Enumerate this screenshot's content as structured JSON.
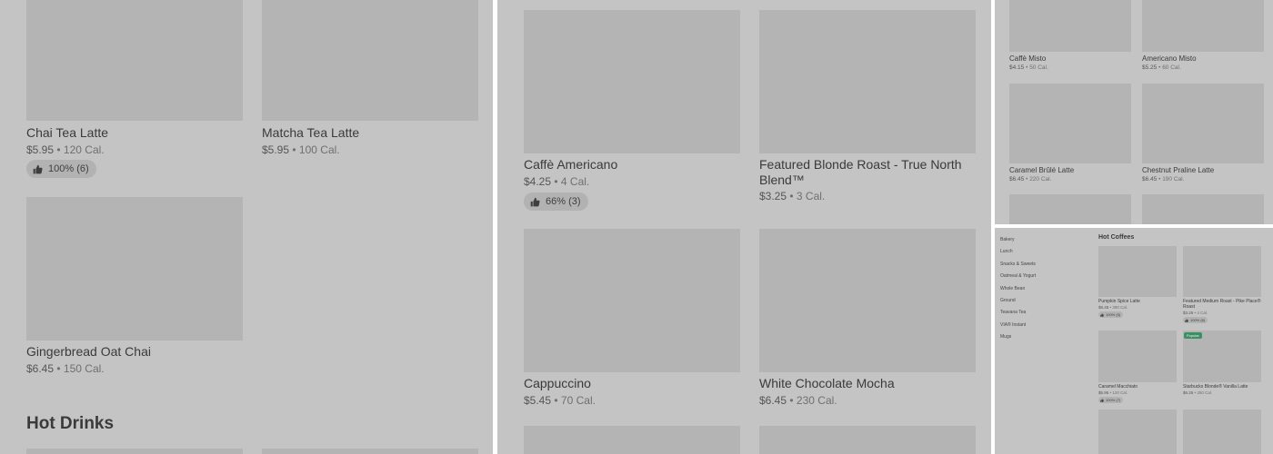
{
  "rating_glyph": "thumbs-up-icon",
  "separator": "•",
  "panel1": {
    "items": [
      {
        "name": "Chai Tea Latte",
        "price": "$5.95",
        "calories": "120 Cal.",
        "rating": "100% (6)"
      },
      {
        "name": "Matcha Tea Latte",
        "price": "$5.95",
        "calories": "100 Cal."
      },
      {
        "name": "Gingerbread Oat Chai",
        "price": "$6.45",
        "calories": "150 Cal."
      }
    ],
    "section_heading": "Hot Drinks"
  },
  "panel2": {
    "items": [
      {
        "name": "Caffè Americano",
        "price": "$4.25",
        "calories": "4 Cal.",
        "rating": "66% (3)"
      },
      {
        "name": "Featured Blonde Roast - True North Blend™",
        "price": "$3.25",
        "calories": "3 Cal."
      },
      {
        "name": "Cappuccino",
        "price": "$5.45",
        "calories": "70 Cal."
      },
      {
        "name": "White Chocolate Mocha",
        "price": "$6.45",
        "calories": "230 Cal."
      }
    ]
  },
  "panel3": {
    "items": [
      {
        "name": "Caffè Misto",
        "price": "$4.15",
        "calories": "50 Cal."
      },
      {
        "name": "Americano Misto",
        "price": "$5.25",
        "calories": "60 Cal."
      },
      {
        "name": "Caramel Brûlé Latte",
        "price": "$6.45",
        "calories": "220 Cal."
      },
      {
        "name": "Chestnut Praline Latte",
        "price": "$6.45",
        "calories": "190 Cal."
      }
    ]
  },
  "panel4": {
    "sidebar": [
      "Bakery",
      "Lunch",
      "Snacks & Sweets",
      "Oatmeal & Yogurt",
      "Whole Bean",
      "Ground",
      "Teavana Tea",
      "VIA® Instant",
      "Mugs"
    ],
    "section_title": "Hot Coffees",
    "items": [
      {
        "name": "Pumpkin Spice Latte",
        "price": "$6.45",
        "calories": "390 Cal.",
        "rating": "100% (5)"
      },
      {
        "name": "Featured Medium Roast - Pike Place® Roast",
        "price": "$3.25",
        "calories": "4 Cal.",
        "rating": "100% (6)"
      },
      {
        "name": "Caramel Macchiato",
        "price": "$5.95",
        "calories": "120 Cal.",
        "rating": "100% (7)"
      },
      {
        "name": "Starbucks Blonde® Vanilla Latte",
        "price": "$6.25",
        "calories": "250 Cal.",
        "badge": "Popular"
      }
    ]
  }
}
